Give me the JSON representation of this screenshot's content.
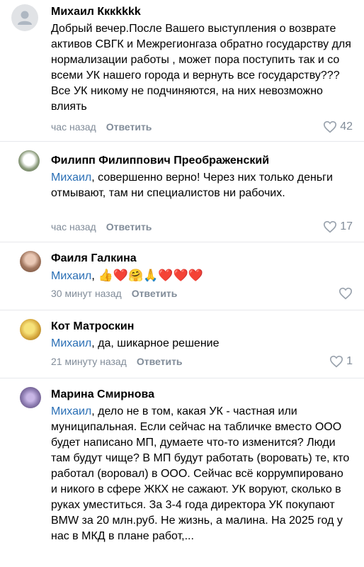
{
  "comments": [
    {
      "author": "Михаил Кккkkkk",
      "mention": "",
      "text": "Добрый вечер.После Вашего выступления  о возврате активов СВГК и Межрегионгаза обратно государству для нормализации работы , может пора поступить так и со всеми УК нашего города и вернуть все государству???Все УК никому не подчиняются, на них невозможно влиять",
      "time": "час назад",
      "reply_label": "Ответить",
      "likes": "42"
    },
    {
      "author": "Филипп Филиппович Преображенский",
      "mention": "Михаил",
      "text": ", совершенно верно! Через них только деньги отмывают, там ни специалистов ни рабочих.",
      "time": "час назад",
      "reply_label": "Ответить",
      "likes": "17"
    },
    {
      "author": "Фаиля Галкина",
      "mention": "Михаил",
      "text": ", 👍❤️🤗🙏❤️❤️❤️",
      "time": "30 минут назад",
      "reply_label": "Ответить",
      "likes": ""
    },
    {
      "author": "Кот Матроскин",
      "mention": "Михаил",
      "text": ", да, шикарное решение",
      "time": "21 минуту назад",
      "reply_label": "Ответить",
      "likes": "1"
    },
    {
      "author": "Марина Смирнова",
      "mention": "Михаил",
      "text": ", дело не в том, какая УК - частная или муниципальная. Если сейчас на табличке вместо ООО будет написано МП, думаете что-то изменится? Люди там будут чище? В МП будут работать (воровать) те, кто работал (воровал) в ООО. Сейчас всё коррумпировано и никого в сфере ЖКХ не сажают. УК воруют, сколько в руках уместиться. За 3-4 года директора УК покупают BMW за 20 млн.руб. Не жизнь, а малина. На 2025 год у нас в МКД в плане работ,...",
      "time": "",
      "reply_label": "",
      "likes": ""
    }
  ],
  "colors": {
    "mention": "#2a6fb5",
    "meta": "#818c99",
    "divider": "#e7e8ec"
  },
  "icons": [
    "default-avatar-icon",
    "heart-outline-icon"
  ]
}
